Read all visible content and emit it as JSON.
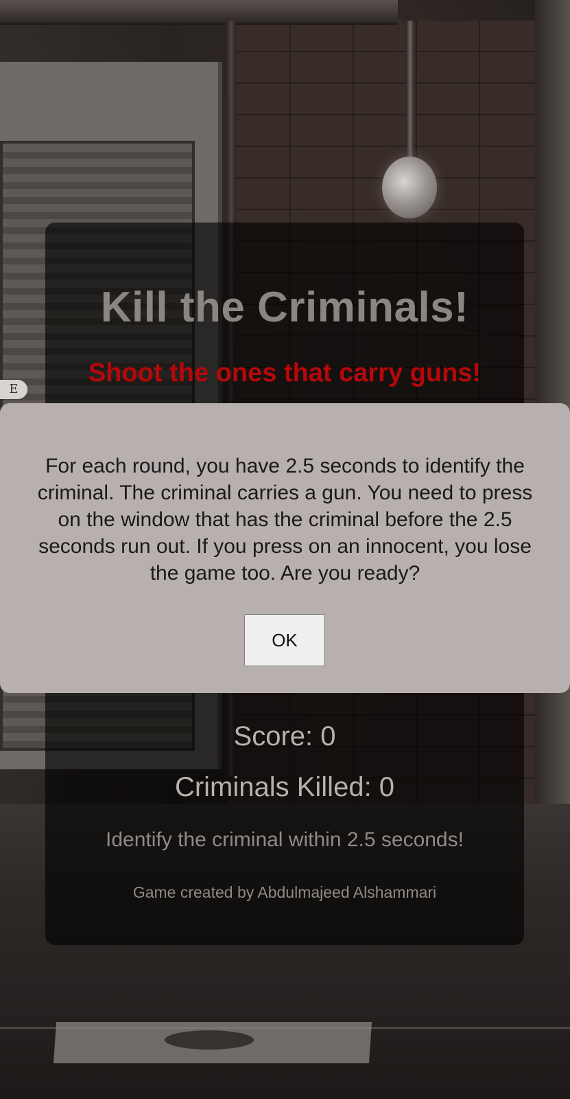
{
  "game": {
    "title": "Kill the Criminals!",
    "subtitle": "Shoot the ones that carry guns!",
    "score_text": "Score: 0",
    "criminals_killed_text": "Criminals Killed: 0",
    "hint": "Identify the criminal within 2.5 seconds!",
    "credit": "Game created by Abdulmajeed Alshammari"
  },
  "dialog": {
    "message": "For each round, you have 2.5 seconds to identify the criminal. The criminal carries a gun. You need to press on the window that has the criminal before the 2.5 seconds run out. If you press on an innocent, you lose the game too. Are you ready?",
    "ok_label": "OK"
  },
  "background": {
    "side_sign_text": "E"
  },
  "colors": {
    "subtitle": "#b5080a",
    "title": "#8a8683",
    "dialog_background": "#b8b0af",
    "panel_overlay": "rgba(0,0,0,0.62)"
  }
}
